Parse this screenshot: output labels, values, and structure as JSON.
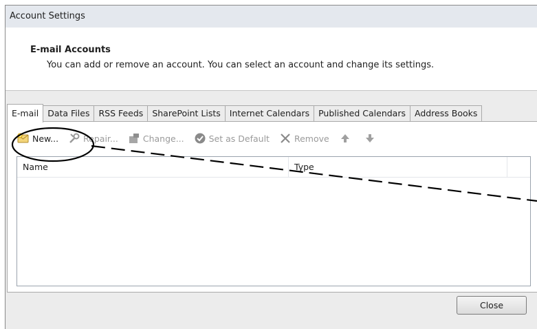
{
  "window": {
    "title": "Account Settings"
  },
  "header": {
    "title": "E-mail Accounts",
    "description": "You can add or remove an account. You can select an account and change its settings."
  },
  "tabs": [
    {
      "label": "E-mail",
      "active": true
    },
    {
      "label": "Data Files"
    },
    {
      "label": "RSS Feeds"
    },
    {
      "label": "SharePoint Lists"
    },
    {
      "label": "Internet Calendars"
    },
    {
      "label": "Published Calendars"
    },
    {
      "label": "Address Books"
    }
  ],
  "toolbar": {
    "new_label": "New...",
    "repair_label": "Repair...",
    "change_label": "Change...",
    "set_default_label": "Set as Default",
    "remove_label": "Remove",
    "icons": [
      "new-account-icon",
      "repair-icon",
      "change-icon",
      "set-default-icon",
      "remove-icon",
      "move-up-icon",
      "move-down-icon"
    ]
  },
  "list": {
    "columns": [
      "Name",
      "Type"
    ],
    "rows": []
  },
  "footer": {
    "close_label": "Close"
  },
  "colors": {
    "annotation": "#000000",
    "disabled_text": "#9a9a9a",
    "set_default_icon": "#8a8a8a"
  }
}
